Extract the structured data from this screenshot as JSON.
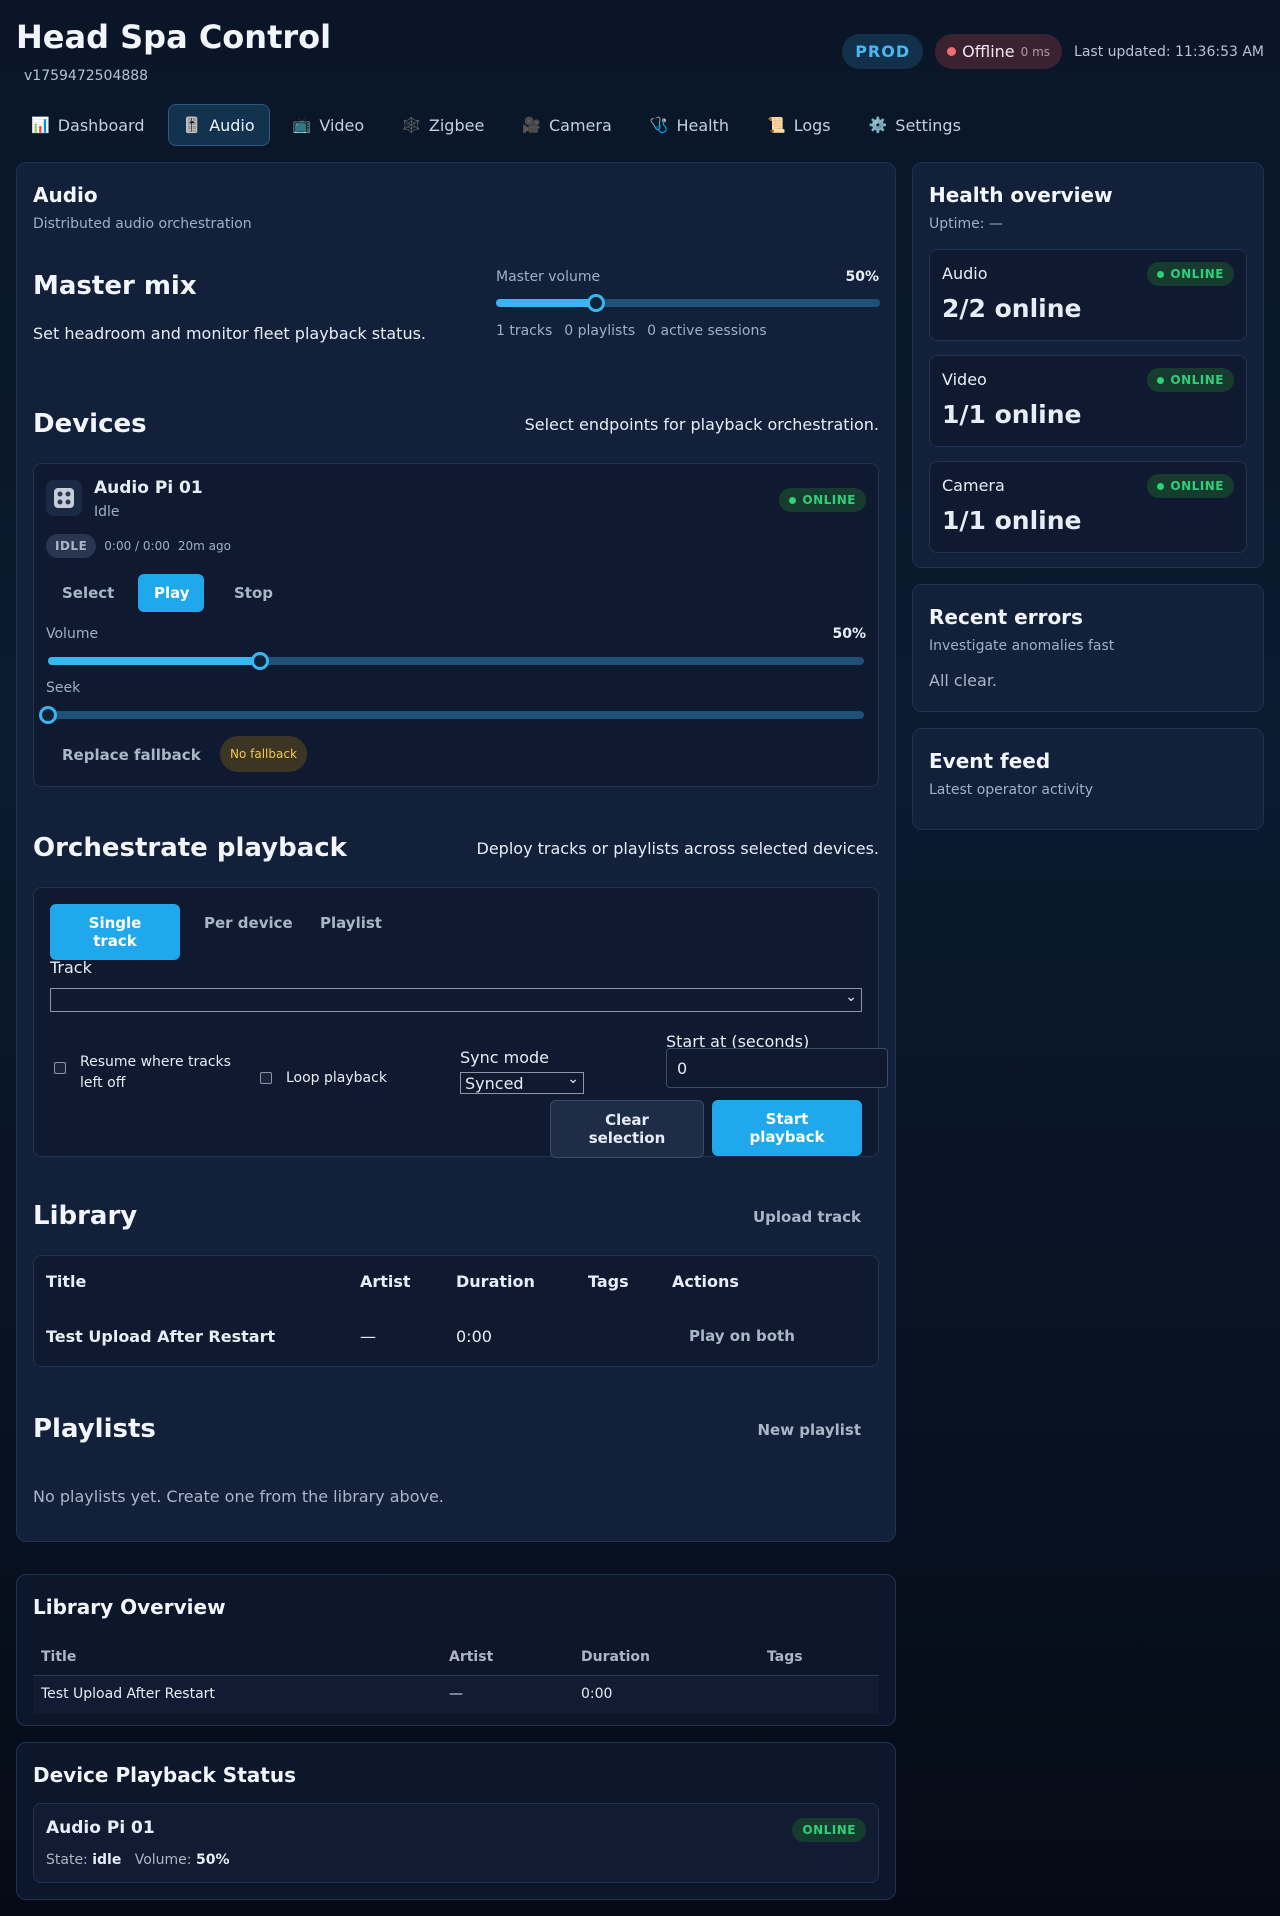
{
  "header": {
    "title": "Head Spa Control",
    "version": "v1759472504888",
    "env": "PROD",
    "connection": {
      "label": "Offline",
      "latency": "0 ms"
    },
    "last_updated": "Last updated: 11:36:53 AM"
  },
  "nav": [
    {
      "label": "Dashboard",
      "icon": "📊"
    },
    {
      "label": "Audio",
      "icon": "🎚️"
    },
    {
      "label": "Video",
      "icon": "📺"
    },
    {
      "label": "Zigbee",
      "icon": "🕸️"
    },
    {
      "label": "Camera",
      "icon": "🎥"
    },
    {
      "label": "Health",
      "icon": "🩺"
    },
    {
      "label": "Logs",
      "icon": "📜"
    },
    {
      "label": "Settings",
      "icon": "⚙️"
    }
  ],
  "audio": {
    "title": "Audio",
    "subtitle": "Distributed audio orchestration",
    "master": {
      "heading": "Master mix",
      "description": "Set headroom and monitor fleet playback status.",
      "volume_label": "Master volume",
      "volume_text": "50%",
      "volume": 0.26,
      "stats": [
        "1 tracks",
        "0 playlists",
        "0 active sessions"
      ]
    },
    "devices": {
      "heading": "Devices",
      "description": "Select endpoints for playback orchestration.",
      "device": {
        "name": "Audio Pi 01",
        "state": "Idle",
        "status": "ONLINE",
        "state_badge": "IDLE",
        "time": "0:00 / 0:00",
        "ago": "20m ago",
        "buttons": [
          "Select",
          "Play",
          "Stop"
        ],
        "volume_label": "Volume",
        "volume_text": "50%",
        "volume": 0.26,
        "seek_label": "Seek",
        "seek": 0.0,
        "fallback_button": "Replace fallback",
        "fallback_badge": "No fallback"
      }
    },
    "orchestrate": {
      "heading": "Orchestrate playback",
      "description": "Deploy tracks or playlists across selected devices.",
      "modes": [
        "Single track",
        "Per device",
        "Playlist"
      ],
      "track_label": "Track",
      "track_value": "",
      "resume_label": "Resume where tracks left off",
      "loop_label": "Loop playback",
      "sync_label": "Sync mode",
      "sync_value": "Synced",
      "start_label": "Start at (seconds)",
      "start_value": "0",
      "clear_button": "Clear selection",
      "start_button": "Start playback"
    },
    "library": {
      "heading": "Library",
      "upload_button": "Upload track",
      "columns": [
        "Title",
        "Artist",
        "Duration",
        "Tags",
        "Actions"
      ],
      "rows": [
        {
          "title": "Test Upload After Restart",
          "artist": "—",
          "duration": "0:00",
          "tags": "",
          "action": "Play on both"
        }
      ]
    },
    "playlists": {
      "heading": "Playlists",
      "new_button": "New playlist",
      "empty": "No playlists yet. Create one from the library above."
    }
  },
  "library_overview": {
    "heading": "Library Overview",
    "columns": [
      "Title",
      "Artist",
      "Duration",
      "Tags"
    ],
    "rows": [
      {
        "title": "Test Upload After Restart",
        "artist": "—",
        "duration": "0:00",
        "tags": ""
      }
    ]
  },
  "device_status": {
    "heading": "Device Playback Status",
    "device": {
      "name": "Audio Pi 01",
      "status": "ONLINE",
      "state_label": "State:",
      "state": "idle",
      "volume_label": "Volume:",
      "volume": "50%"
    }
  },
  "health": {
    "heading": "Health overview",
    "uptime": "Uptime: —",
    "cards": [
      {
        "name": "Audio",
        "status": "ONLINE",
        "value": "2/2 online"
      },
      {
        "name": "Video",
        "status": "ONLINE",
        "value": "1/1 online"
      },
      {
        "name": "Camera",
        "status": "ONLINE",
        "value": "1/1 online"
      }
    ]
  },
  "errors": {
    "heading": "Recent errors",
    "subtitle": "Investigate anomalies fast",
    "message": "All clear."
  },
  "events": {
    "heading": "Event feed",
    "subtitle": "Latest operator activity"
  },
  "colors": {
    "accent": "#38b6f2",
    "online": "#2fd07a",
    "offline": "#f26d6d",
    "background": "#0a1628"
  }
}
